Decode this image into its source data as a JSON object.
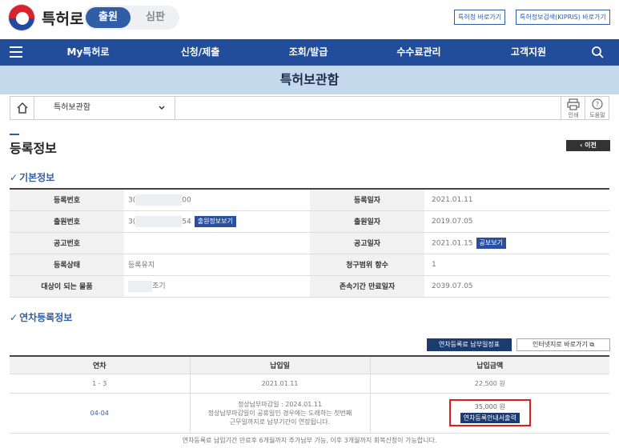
{
  "header": {
    "brand": "특허로",
    "tab_active": "출원",
    "tab_inactive": "심판",
    "link_1": "특허청 바로가기",
    "link_2": "특허정보검색(KIPRIS) 바로가기"
  },
  "nav": {
    "items": [
      "My특허로",
      "신청/제출",
      "조회/발급",
      "수수료관리",
      "고객지원"
    ]
  },
  "banner": {
    "title": "특허보관함"
  },
  "breadcrumb": {
    "selected": "특허보관함",
    "print": "인쇄",
    "help": "도움말"
  },
  "page": {
    "title": "등록정보",
    "back": "이전"
  },
  "basic": {
    "title": "기본정보",
    "reg_no_label": "등록번호",
    "reg_no_prefix": "3(",
    "reg_no_suffix": "00",
    "reg_date_label": "등록일자",
    "reg_date": "2021.01.11",
    "app_no_label": "출원번호",
    "app_no_prefix": "3(",
    "app_no_suffix": "54",
    "app_info_btn": "출원정보보기",
    "app_date_label": "출원일자",
    "app_date": "2019.07.05",
    "pub_no_label": "공고번호",
    "pub_date_label": "공고일자",
    "pub_date": "2021.01.15",
    "pub_btn": "공보보기",
    "status_label": "등록상태",
    "status": "등록유지",
    "claims_label": "청구범위 항수",
    "claims": "1",
    "goods_label": "대상이 되는 물품",
    "goods_suffix": "조기",
    "expiry_label": "존속기간 만료일자",
    "expiry": "2039.07.05"
  },
  "annual": {
    "title": "연차등록정보",
    "btn_pay": "연차등록료 납부일정표",
    "btn_internet": "인터넷지로 바로가기",
    "headers": [
      "연차",
      "납입일",
      "납입금액"
    ],
    "row1": {
      "year": "1 - 3",
      "date": "2021.01.11",
      "amount": "22,500 원"
    },
    "row2": {
      "year": "04-04",
      "due_line1": "정상납부마감일 : 2024.01.11",
      "due_line2": "정상납부마감일이 공휴일인 경우에는 도래하는 첫번째",
      "due_line3": "근무일까지로 납부기간이 연장됩니다.",
      "amount": "35,000 원",
      "print_btn": "연차등록안내서출력"
    },
    "note": "연차등록료 납입기간 만료후 6개월까지 추가납부 가능, 이후 3개월까지 회복신청이 가능합니다."
  }
}
